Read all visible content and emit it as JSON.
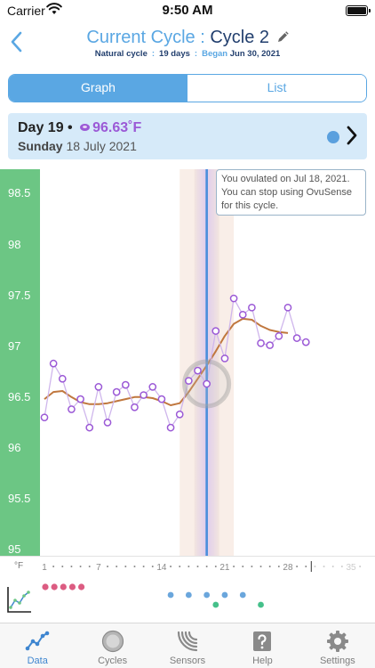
{
  "status_bar": {
    "carrier": "Carrier",
    "time": "9:50 AM"
  },
  "header": {
    "title_prefix": "Current Cycle",
    "title_colon": " : ",
    "title_cycle": "Cycle 2",
    "subtitle_type": "Natural cycle",
    "subtitle_days": "19 days",
    "subtitle_began_label": "Began",
    "subtitle_began_date": "Jun 30, 2021"
  },
  "segmented": {
    "graph_label": "Graph",
    "list_label": "List",
    "selected": "Graph"
  },
  "day_banner": {
    "day": "Day 19",
    "bullet": "•",
    "temperature": "96.63",
    "unit": "˚F",
    "weekday": "Sunday",
    "date": "18 July 2021"
  },
  "tooltip": {
    "text": "You ovulated on Jul 18, 2021. You can stop using OvuSense for this cycle."
  },
  "colors": {
    "accent": "#5aa7e3",
    "axis_green": "#6cc684",
    "temp_purple": "#9b59d6",
    "trend_orange": "#c0773e",
    "fertile_band": "#f7e8e0",
    "ovulation_line": "#4a8fdc",
    "period_pink": "#dc5c82"
  },
  "chart_data": {
    "type": "line",
    "y_ticks": [
      "98.5",
      "98",
      "97.5",
      "97",
      "96.5",
      "96",
      "95.5",
      "95"
    ],
    "ylim": [
      94.94,
      98.74
    ],
    "xlim": [
      1,
      36
    ],
    "x_unit": "°F",
    "x_tick_labels": [
      "1",
      "7",
      "14",
      "21",
      "28",
      "35"
    ],
    "fertile_window": [
      16,
      22
    ],
    "ovulation_day": 19,
    "series": [
      {
        "name": "",
        "x": [
          1,
          2,
          3,
          4,
          5,
          6,
          7,
          8,
          9,
          10,
          11,
          12,
          13,
          14,
          15,
          16,
          17,
          18,
          19,
          20,
          21,
          22,
          23,
          24,
          25,
          26,
          27,
          28,
          29,
          30
        ],
        "values": [
          96.3,
          96.83,
          96.68,
          96.38,
          96.48,
          96.2,
          96.6,
          96.25,
          96.55,
          96.62,
          96.4,
          96.52,
          96.6,
          96.48,
          96.2,
          96.33,
          96.66,
          96.76,
          96.63,
          97.15,
          96.88,
          97.47,
          97.31,
          97.38,
          97.03,
          97.01,
          97.1,
          97.38,
          97.08,
          97.04
        ]
      },
      {
        "name": "",
        "x": [
          1,
          2,
          3,
          4,
          5,
          6,
          7,
          8,
          9,
          10,
          11,
          12,
          13,
          14,
          15,
          16,
          17,
          18,
          19,
          20,
          21,
          22,
          23,
          24,
          25,
          26,
          27,
          28
        ],
        "values": [
          96.48,
          96.55,
          96.56,
          96.5,
          96.45,
          96.43,
          96.43,
          96.44,
          96.46,
          96.48,
          96.5,
          96.5,
          96.49,
          96.46,
          96.42,
          96.44,
          96.55,
          96.68,
          96.81,
          96.95,
          97.1,
          97.22,
          97.27,
          97.26,
          97.2,
          97.16,
          97.14,
          97.13
        ]
      }
    ]
  },
  "event_markers": {
    "period_days": [
      1,
      2,
      3,
      4,
      5
    ],
    "blue_dot_days": [
      15,
      17,
      19,
      21,
      23
    ],
    "green_dot_days": [
      20,
      25
    ]
  },
  "tabs": [
    {
      "label": "Data",
      "icon": "data-chart-icon",
      "active": true
    },
    {
      "label": "Cycles",
      "icon": "cycle-circle-icon",
      "active": false
    },
    {
      "label": "Sensors",
      "icon": "sensor-waves-icon",
      "active": false
    },
    {
      "label": "Help",
      "icon": "help-question-icon",
      "active": false
    },
    {
      "label": "Settings",
      "icon": "settings-gear-icon",
      "active": false
    }
  ]
}
